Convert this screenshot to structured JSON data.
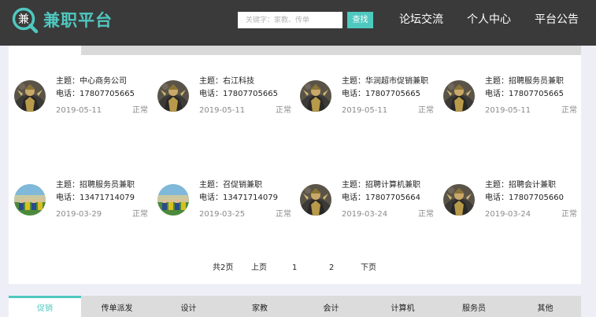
{
  "header": {
    "logo_glyph": "兼",
    "logo_text": "兼职平台",
    "search_placeholder": "关键字：家教、传单",
    "search_button": "查找",
    "nav": [
      "论坛交流",
      "个人中心",
      "平台公告"
    ]
  },
  "listings": [
    {
      "title": "主题：中心商务公司",
      "phone": "电话：17807705665",
      "date": "2019-05-11",
      "status": "正常",
      "avatar": "warrior-avatar"
    },
    {
      "title": "主题：右江科技",
      "phone": "电话：17807705665",
      "date": "2019-05-11",
      "status": "正常",
      "avatar": "warrior-avatar"
    },
    {
      "title": "主题：华润超市促销兼职",
      "phone": "电话：17807705665",
      "date": "2019-05-11",
      "status": "正常",
      "avatar": "warrior-avatar"
    },
    {
      "title": "主题：招聘服务员兼职",
      "phone": "电话：17807705665",
      "date": "2019-05-11",
      "status": "正常",
      "avatar": "warrior-avatar"
    },
    {
      "title": "主题：招聘服务员兼职",
      "phone": "电话：13471714079",
      "date": "2019-03-29",
      "status": "正常",
      "avatar": "team-avatar"
    },
    {
      "title": "主题：召促销兼职",
      "phone": "电话：13471714079",
      "date": "2019-03-25",
      "status": "正常",
      "avatar": "team-avatar"
    },
    {
      "title": "主题：招聘计算机兼职",
      "phone": "电话：17807705664",
      "date": "2019-03-24",
      "status": "正常",
      "avatar": "warrior-avatar"
    },
    {
      "title": "主题：招聘会计兼职",
      "phone": "电话：17807705660",
      "date": "2019-03-24",
      "status": "正常",
      "avatar": "warrior-avatar"
    }
  ],
  "pagination": {
    "total": "共2页",
    "prev": "上页",
    "pages": [
      "1",
      "2"
    ],
    "next": "下页"
  },
  "categories": [
    "促销",
    "传单派发",
    "设计",
    "家教",
    "会计",
    "计算机",
    "服务员",
    "其他"
  ],
  "active_category": 0,
  "colors": {
    "accent": "#4fc8c0",
    "header_bg": "#3a3a3a",
    "page_bg": "#eeeef6"
  }
}
